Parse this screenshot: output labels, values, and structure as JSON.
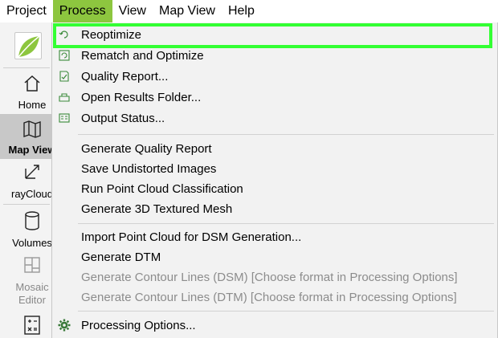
{
  "menubar": {
    "items": [
      "Project",
      "Process",
      "View",
      "Map View",
      "Help"
    ],
    "active": "Process",
    "active_color": "#8dc63f"
  },
  "sidebar": {
    "logo": "pix4d-logo",
    "items": [
      {
        "label": "Home",
        "icon": "home-icon"
      },
      {
        "label": "Map View",
        "icon": "map-icon",
        "active": true
      },
      {
        "label": "rayCloud",
        "icon": "raycloud-icon"
      },
      {
        "label": "Volumes",
        "icon": "volumes-icon"
      },
      {
        "label": "Mosaic\nEditor",
        "icon": "mosaic-editor-icon",
        "disabled": true
      },
      {
        "label": "",
        "icon": "index-calculator-icon"
      }
    ]
  },
  "process_menu": {
    "group1": [
      {
        "label": "Reoptimize",
        "icon": "reoptimize-icon"
      },
      {
        "label": "Rematch and Optimize",
        "icon": "rematch-icon"
      },
      {
        "label": "Quality Report...",
        "icon": "quality-report-icon"
      },
      {
        "label": "Open Results Folder...",
        "icon": "folder-icon"
      },
      {
        "label": "Output Status...",
        "icon": "output-status-icon"
      }
    ],
    "group2": [
      {
        "label": "Generate Quality Report"
      },
      {
        "label": "Save Undistorted Images"
      },
      {
        "label": "Run Point Cloud Classification"
      },
      {
        "label": "Generate 3D Textured Mesh"
      }
    ],
    "group3": [
      {
        "label": "Import Point Cloud for DSM Generation..."
      },
      {
        "label": "Generate DTM"
      },
      {
        "label": "Generate Contour Lines (DSM) [Choose format in Processing Options]",
        "disabled": true
      },
      {
        "label": "Generate Contour Lines (DTM) [Choose format in Processing Options]",
        "disabled": true
      }
    ],
    "group4": [
      {
        "label": "Processing Options...",
        "icon": "gear-icon"
      }
    ]
  },
  "highlight_color": "#33ff33"
}
